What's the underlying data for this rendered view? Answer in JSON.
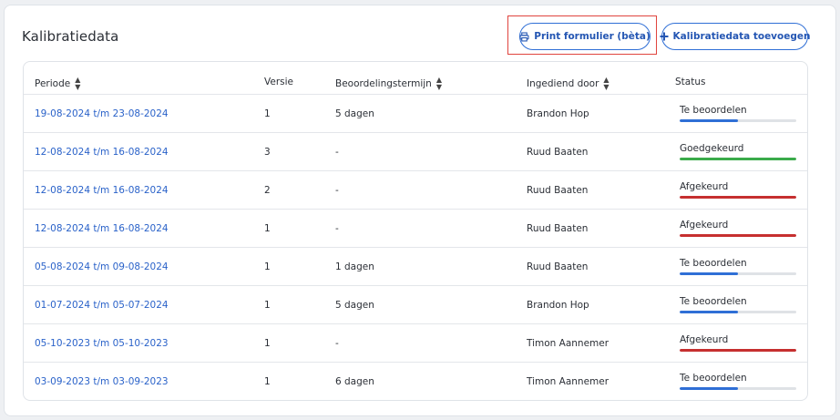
{
  "card": {
    "title": "Kalibratiedata",
    "print_button": "Print formulier (bèta)",
    "add_button": "Kalibratiedata toevoegen"
  },
  "table": {
    "headers": {
      "periode": "Periode",
      "versie": "Versie",
      "termijn": "Beoordelingstermijn",
      "ingediend": "Ingediend door",
      "status": "Status"
    },
    "rows": [
      {
        "periode": "19-08-2024 t/m 23-08-2024",
        "versie": "1",
        "termijn": "5 dagen",
        "ingediend": "Brandon Hop",
        "status": "Te beoordelen",
        "status_type": "review",
        "progress": 0.5
      },
      {
        "periode": "12-08-2024 t/m 16-08-2024",
        "versie": "3",
        "termijn": "-",
        "ingediend": "Ruud Baaten",
        "status": "Goedgekeurd",
        "status_type": "approved",
        "progress": 1
      },
      {
        "periode": "12-08-2024 t/m 16-08-2024",
        "versie": "2",
        "termijn": "-",
        "ingediend": "Ruud Baaten",
        "status": "Afgekeurd",
        "status_type": "rejected",
        "progress": 1
      },
      {
        "periode": "12-08-2024 t/m 16-08-2024",
        "versie": "1",
        "termijn": "-",
        "ingediend": "Ruud Baaten",
        "status": "Afgekeurd",
        "status_type": "rejected",
        "progress": 1
      },
      {
        "periode": "05-08-2024 t/m 09-08-2024",
        "versie": "1",
        "termijn": "1 dagen",
        "ingediend": "Ruud Baaten",
        "status": "Te beoordelen",
        "status_type": "review",
        "progress": 0.5
      },
      {
        "periode": "01-07-2024 t/m 05-07-2024",
        "versie": "1",
        "termijn": "5 dagen",
        "ingediend": "Brandon Hop",
        "status": "Te beoordelen",
        "status_type": "review",
        "progress": 0.5
      },
      {
        "periode": "05-10-2023 t/m 05-10-2023",
        "versie": "1",
        "termijn": "-",
        "ingediend": "Timon Aannemer",
        "status": "Afgekeurd",
        "status_type": "rejected",
        "progress": 1
      },
      {
        "periode": "03-09-2023 t/m 03-09-2023",
        "versie": "1",
        "termijn": "6 dagen",
        "ingediend": "Timon Aannemer",
        "status": "Te beoordelen",
        "status_type": "review",
        "progress": 0.5
      }
    ]
  },
  "colors": {
    "review": "#2f6fd6",
    "approved": "#3aab4a",
    "rejected": "#c62f2f",
    "highlight": "#e0443e"
  },
  "icons": {
    "print": "printer-icon",
    "add": "plus-icon",
    "sort": "sort-icon"
  }
}
